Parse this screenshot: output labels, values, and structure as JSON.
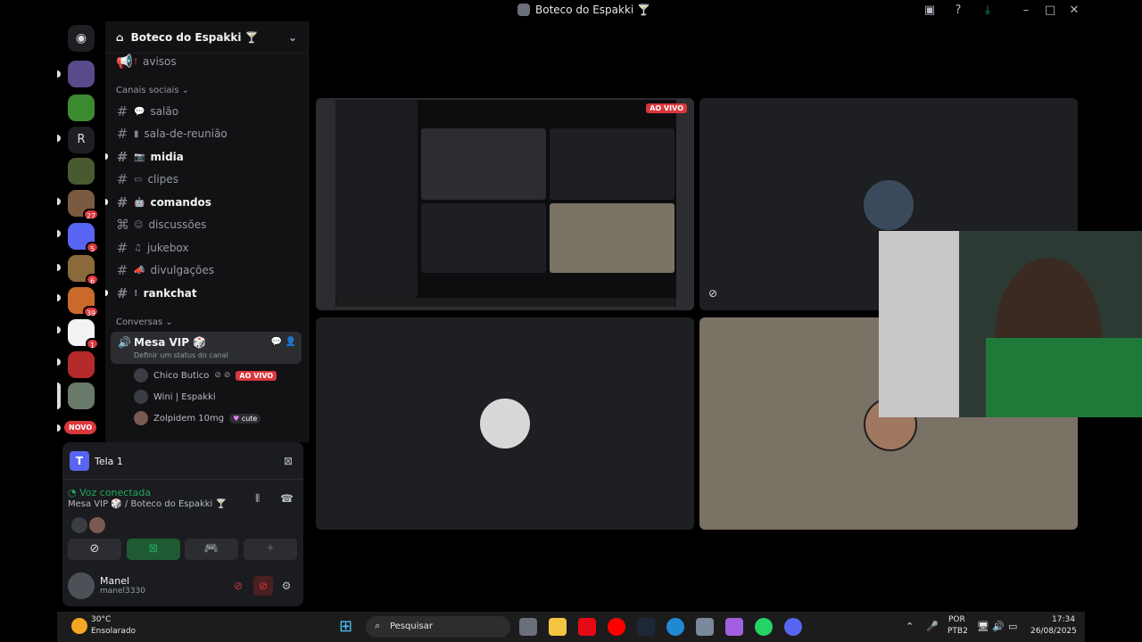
{
  "window": {
    "title": "Boteco do Espakki 🍸"
  },
  "guilds": [
    {
      "name": "guild-1",
      "badge": ""
    },
    {
      "name": "guild-2",
      "badge": ""
    },
    {
      "name": "guild-3",
      "letter": "R",
      "badge": ""
    },
    {
      "name": "guild-4",
      "badge": ""
    },
    {
      "name": "guild-5",
      "badge": "27"
    },
    {
      "name": "guild-6",
      "badge": "5"
    },
    {
      "name": "guild-7",
      "badge": "6"
    },
    {
      "name": "guild-8",
      "badge": "39"
    },
    {
      "name": "guild-9",
      "badge": "1"
    },
    {
      "name": "guild-10",
      "badge": ""
    },
    {
      "name": "guild-11",
      "badge": ""
    }
  ],
  "new_badge": "NOVO",
  "server": {
    "name": "Boteco do Espakki 🍸"
  },
  "channels": {
    "top": {
      "icon": "📢",
      "name": "avisos"
    },
    "social_category": "Canais sociais",
    "social": [
      {
        "name": "salão",
        "bold": false
      },
      {
        "name": "sala-de-reunião",
        "bold": false
      },
      {
        "name": "midia",
        "bold": true
      },
      {
        "name": "clipes",
        "bold": false
      },
      {
        "name": "comandos",
        "bold": true
      },
      {
        "name": "discussões",
        "bold": false
      },
      {
        "name": "jukebox",
        "bold": false
      },
      {
        "name": "divulgações",
        "bold": false
      },
      {
        "name": "rankchat",
        "bold": true
      }
    ],
    "conv_category": "Conversas",
    "voice": {
      "name": "Mesa VIP 🎲",
      "status": "Definir um status do canal",
      "users": [
        {
          "name": "Chico Butico",
          "tag": "AO VIVO"
        },
        {
          "name": "Wini | Espakki",
          "tag": ""
        },
        {
          "name": "Zolpidem 10mg",
          "tag": "cute"
        }
      ]
    }
  },
  "panel": {
    "stream_label": "Tela 1",
    "voice_status": "Voz conectada",
    "voice_where": "Mesa VIP 🎲 / Boteco do Espakki 🍸",
    "user": {
      "name": "Manel",
      "tag": "manel3330"
    }
  },
  "stage": {
    "live_badge": "AO VIVO"
  },
  "taskbar": {
    "weather_temp": "30°C",
    "weather_desc": "Ensolarado",
    "search_placeholder": "Pesquisar",
    "lang": "POR",
    "layout": "PTB2",
    "time": "17:34",
    "date": "26/08/2025"
  }
}
